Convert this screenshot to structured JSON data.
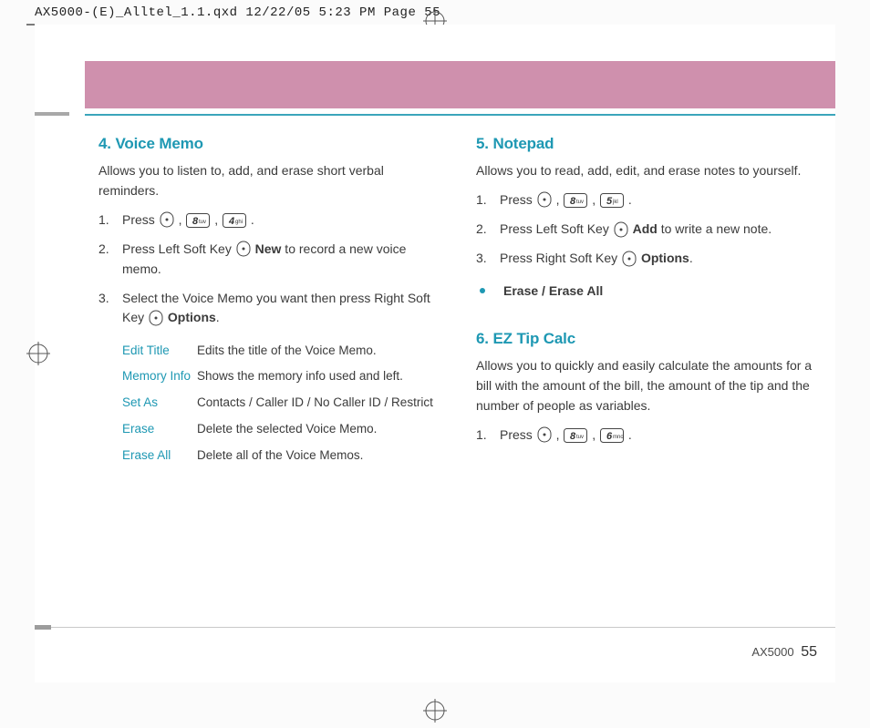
{
  "slug": "AX5000-(E)_Alltel_1.1.qxd  12/22/05  5:23 PM  Page 55",
  "left": {
    "h": "4. Voice Memo",
    "intro": "Allows you to listen to, add, and erase short verbal reminders.",
    "step1_pre": "Press ",
    "step2_pre": "Press Left Soft Key ",
    "step2_bold": "New",
    "step2_post": " to record a new voice memo.",
    "step3_pre": "Select the Voice Memo you want then press Right Soft Key ",
    "step3_bold": "Options",
    "opts": [
      {
        "t": "Edit Title",
        "d": "Edits the title of the Voice Memo."
      },
      {
        "t": "Memory Info",
        "d": "Shows the memory info used and left."
      },
      {
        "t": "Set As",
        "d": "Contacts / Caller ID / No Caller ID / Restrict"
      },
      {
        "t": "Erase",
        "d": "Delete the selected Voice Memo."
      },
      {
        "t": "Erase All",
        "d": "Delete all of the Voice Memos."
      }
    ]
  },
  "right": {
    "notepad_h": "5. Notepad",
    "notepad_intro": "Allows you to read, add, edit, and erase notes to yourself.",
    "np1_pre": "Press ",
    "np2_pre": "Press Left Soft Key ",
    "np2_bold": "Add",
    "np2_post": " to write a new note.",
    "np3_pre": "Press Right Soft Key ",
    "np3_bold": "Options",
    "np_bullet": "Erase / Erase All",
    "ez_h": "6. EZ Tip Calc",
    "ez_intro": "Allows you to quickly and easily calculate the amounts for a bill with the amount of the bill, the amount of the tip and the number of people as variables.",
    "ez1_pre": "Press "
  },
  "footer_model": "AX5000",
  "footer_page": "55",
  "keys": {
    "k4": {
      "big": "4",
      "small": "ghi"
    },
    "k5": {
      "big": "5",
      "small": "jkl"
    },
    "k6": {
      "big": "6",
      "small": "mno"
    },
    "k8": {
      "big": "8",
      "small": "tuv"
    }
  }
}
